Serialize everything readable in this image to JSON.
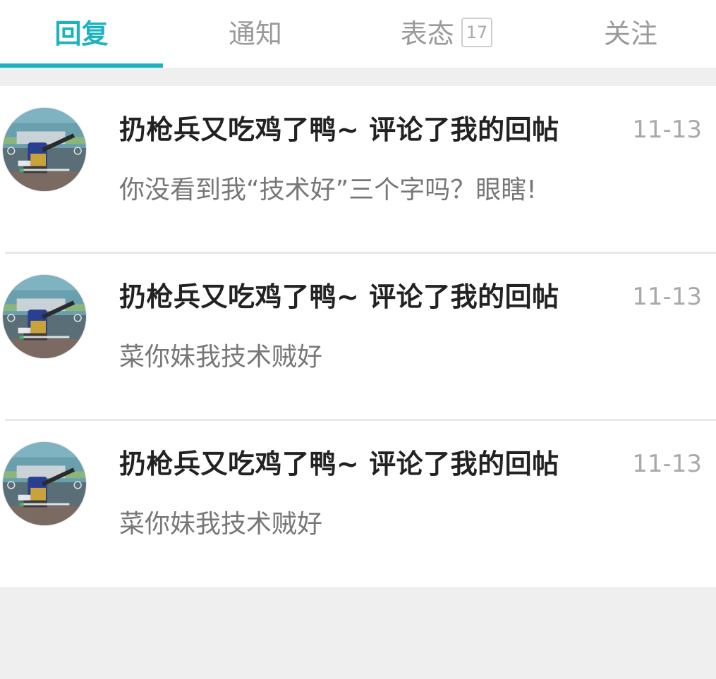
{
  "tabs": [
    {
      "label": "回复",
      "active": true
    },
    {
      "label": "通知",
      "active": false
    },
    {
      "label": "表态",
      "active": false,
      "badge": "17"
    },
    {
      "label": "关注",
      "active": false
    }
  ],
  "colors": {
    "accent": "#1cb3c0",
    "title": "#222222",
    "body": "#777777",
    "time": "#a9a9a9",
    "background": "#efefef"
  },
  "items": [
    {
      "title": "扔枪兵又吃鸡了鸭~ 评论了我的回帖",
      "time": "11-13",
      "content": "你没看到我“技术好”三个字吗？眼瞎!",
      "avatar": "game-screenshot-avatar"
    },
    {
      "title": "扔枪兵又吃鸡了鸭~ 评论了我的回帖",
      "time": "11-13",
      "content": "菜你妹我技术贼好",
      "avatar": "game-screenshot-avatar"
    },
    {
      "title": "扔枪兵又吃鸡了鸭~ 评论了我的回帖",
      "time": "11-13",
      "content": "菜你妹我技术贼好",
      "avatar": "game-screenshot-avatar"
    }
  ]
}
